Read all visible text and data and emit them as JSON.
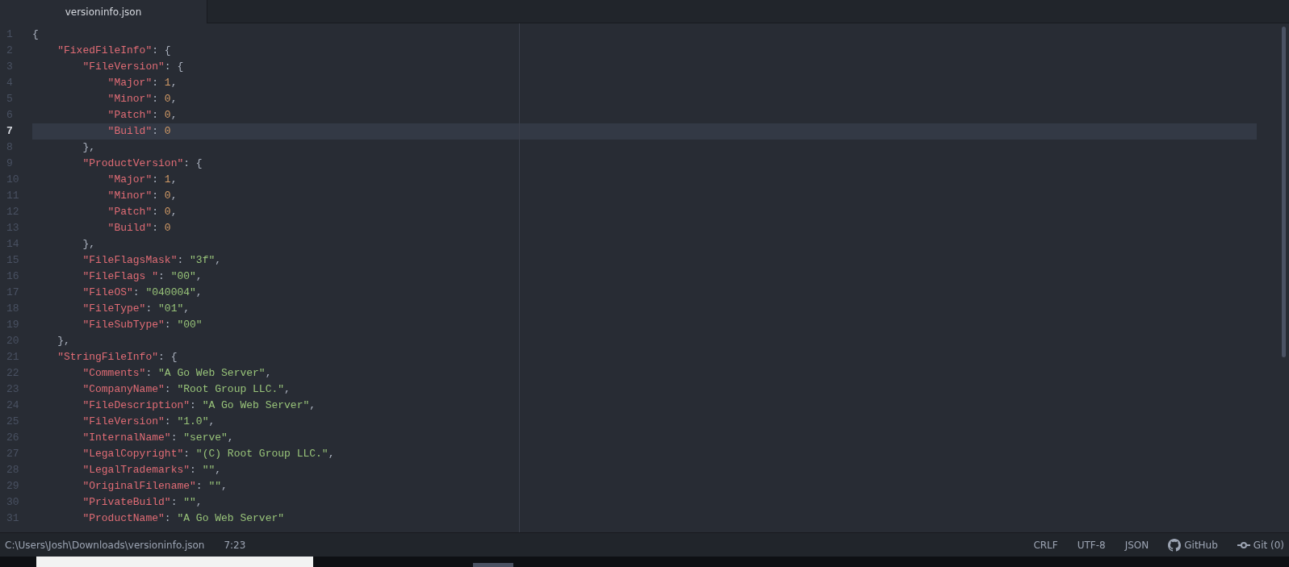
{
  "tabs": [
    {
      "label": "versioninfo.json",
      "selected": true
    }
  ],
  "lines": [
    {
      "number": "1",
      "selected": false,
      "tokens": [
        {
          "kind": "punct",
          "text": "{"
        }
      ]
    },
    {
      "number": "2",
      "selected": false,
      "tokens": [
        {
          "kind": "key",
          "text": "    \"FixedFileInfo\""
        },
        {
          "kind": "punct",
          "text": ": {"
        }
      ]
    },
    {
      "number": "3",
      "selected": false,
      "tokens": [
        {
          "kind": "key",
          "text": "        \"FileVersion\""
        },
        {
          "kind": "punct",
          "text": ": {"
        }
      ]
    },
    {
      "number": "4",
      "selected": false,
      "tokens": [
        {
          "kind": "key",
          "text": "            \"Major\""
        },
        {
          "kind": "punct",
          "text": ": "
        },
        {
          "kind": "number",
          "text": "1"
        },
        {
          "kind": "punct",
          "text": ","
        }
      ]
    },
    {
      "number": "5",
      "selected": false,
      "tokens": [
        {
          "kind": "key",
          "text": "            \"Minor\""
        },
        {
          "kind": "punct",
          "text": ": "
        },
        {
          "kind": "number",
          "text": "0"
        },
        {
          "kind": "punct",
          "text": ","
        }
      ]
    },
    {
      "number": "6",
      "selected": false,
      "tokens": [
        {
          "kind": "key",
          "text": "            \"Patch\""
        },
        {
          "kind": "punct",
          "text": ": "
        },
        {
          "kind": "number",
          "text": "0"
        },
        {
          "kind": "punct",
          "text": ","
        }
      ]
    },
    {
      "number": "7",
      "selected": true,
      "tokens": [
        {
          "kind": "key",
          "text": "            \"Build\""
        },
        {
          "kind": "punct",
          "text": ": "
        },
        {
          "kind": "number",
          "text": "0"
        }
      ]
    },
    {
      "number": "8",
      "selected": false,
      "tokens": [
        {
          "kind": "punct",
          "text": "        },"
        }
      ]
    },
    {
      "number": "9",
      "selected": false,
      "tokens": [
        {
          "kind": "key",
          "text": "        \"ProductVersion\""
        },
        {
          "kind": "punct",
          "text": ": {"
        }
      ]
    },
    {
      "number": "10",
      "selected": false,
      "tokens": [
        {
          "kind": "key",
          "text": "            \"Major\""
        },
        {
          "kind": "punct",
          "text": ": "
        },
        {
          "kind": "number",
          "text": "1"
        },
        {
          "kind": "punct",
          "text": ","
        }
      ]
    },
    {
      "number": "11",
      "selected": false,
      "tokens": [
        {
          "kind": "key",
          "text": "            \"Minor\""
        },
        {
          "kind": "punct",
          "text": ": "
        },
        {
          "kind": "number",
          "text": "0"
        },
        {
          "kind": "punct",
          "text": ","
        }
      ]
    },
    {
      "number": "12",
      "selected": false,
      "tokens": [
        {
          "kind": "key",
          "text": "            \"Patch\""
        },
        {
          "kind": "punct",
          "text": ": "
        },
        {
          "kind": "number",
          "text": "0"
        },
        {
          "kind": "punct",
          "text": ","
        }
      ]
    },
    {
      "number": "13",
      "selected": false,
      "tokens": [
        {
          "kind": "key",
          "text": "            \"Build\""
        },
        {
          "kind": "punct",
          "text": ": "
        },
        {
          "kind": "number",
          "text": "0"
        }
      ]
    },
    {
      "number": "14",
      "selected": false,
      "tokens": [
        {
          "kind": "punct",
          "text": "        },"
        }
      ]
    },
    {
      "number": "15",
      "selected": false,
      "tokens": [
        {
          "kind": "key",
          "text": "        \"FileFlagsMask\""
        },
        {
          "kind": "punct",
          "text": ": "
        },
        {
          "kind": "string",
          "text": "\"3f\""
        },
        {
          "kind": "punct",
          "text": ","
        }
      ]
    },
    {
      "number": "16",
      "selected": false,
      "tokens": [
        {
          "kind": "key",
          "text": "        \"FileFlags \""
        },
        {
          "kind": "punct",
          "text": ": "
        },
        {
          "kind": "string",
          "text": "\"00\""
        },
        {
          "kind": "punct",
          "text": ","
        }
      ]
    },
    {
      "number": "17",
      "selected": false,
      "tokens": [
        {
          "kind": "key",
          "text": "        \"FileOS\""
        },
        {
          "kind": "punct",
          "text": ": "
        },
        {
          "kind": "string",
          "text": "\"040004\""
        },
        {
          "kind": "punct",
          "text": ","
        }
      ]
    },
    {
      "number": "18",
      "selected": false,
      "tokens": [
        {
          "kind": "key",
          "text": "        \"FileType\""
        },
        {
          "kind": "punct",
          "text": ": "
        },
        {
          "kind": "string",
          "text": "\"01\""
        },
        {
          "kind": "punct",
          "text": ","
        }
      ]
    },
    {
      "number": "19",
      "selected": false,
      "tokens": [
        {
          "kind": "key",
          "text": "        \"FileSubType\""
        },
        {
          "kind": "punct",
          "text": ": "
        },
        {
          "kind": "string",
          "text": "\"00\""
        }
      ]
    },
    {
      "number": "20",
      "selected": false,
      "tokens": [
        {
          "kind": "punct",
          "text": "    },"
        }
      ]
    },
    {
      "number": "21",
      "selected": false,
      "tokens": [
        {
          "kind": "key",
          "text": "    \"StringFileInfo\""
        },
        {
          "kind": "punct",
          "text": ": {"
        }
      ]
    },
    {
      "number": "22",
      "selected": false,
      "tokens": [
        {
          "kind": "key",
          "text": "        \"Comments\""
        },
        {
          "kind": "punct",
          "text": ": "
        },
        {
          "kind": "string",
          "text": "\"A Go Web Server\""
        },
        {
          "kind": "punct",
          "text": ","
        }
      ]
    },
    {
      "number": "23",
      "selected": false,
      "tokens": [
        {
          "kind": "key",
          "text": "        \"CompanyName\""
        },
        {
          "kind": "punct",
          "text": ": "
        },
        {
          "kind": "string",
          "text": "\"Root Group LLC.\""
        },
        {
          "kind": "punct",
          "text": ","
        }
      ]
    },
    {
      "number": "24",
      "selected": false,
      "tokens": [
        {
          "kind": "key",
          "text": "        \"FileDescription\""
        },
        {
          "kind": "punct",
          "text": ": "
        },
        {
          "kind": "string",
          "text": "\"A Go Web Server\""
        },
        {
          "kind": "punct",
          "text": ","
        }
      ]
    },
    {
      "number": "25",
      "selected": false,
      "tokens": [
        {
          "kind": "key",
          "text": "        \"FileVersion\""
        },
        {
          "kind": "punct",
          "text": ": "
        },
        {
          "kind": "string",
          "text": "\"1.0\""
        },
        {
          "kind": "punct",
          "text": ","
        }
      ]
    },
    {
      "number": "26",
      "selected": false,
      "tokens": [
        {
          "kind": "key",
          "text": "        \"InternalName\""
        },
        {
          "kind": "punct",
          "text": ": "
        },
        {
          "kind": "string",
          "text": "\"serve\""
        },
        {
          "kind": "punct",
          "text": ","
        }
      ]
    },
    {
      "number": "27",
      "selected": false,
      "tokens": [
        {
          "kind": "key",
          "text": "        \"LegalCopyright\""
        },
        {
          "kind": "punct",
          "text": ": "
        },
        {
          "kind": "string",
          "text": "\"(C) Root Group LLC.\""
        },
        {
          "kind": "punct",
          "text": ","
        }
      ]
    },
    {
      "number": "28",
      "selected": false,
      "tokens": [
        {
          "kind": "key",
          "text": "        \"LegalTrademarks\""
        },
        {
          "kind": "punct",
          "text": ": "
        },
        {
          "kind": "string",
          "text": "\"\""
        },
        {
          "kind": "punct",
          "text": ","
        }
      ]
    },
    {
      "number": "29",
      "selected": false,
      "tokens": [
        {
          "kind": "key",
          "text": "        \"OriginalFilename\""
        },
        {
          "kind": "punct",
          "text": ": "
        },
        {
          "kind": "string",
          "text": "\"\""
        },
        {
          "kind": "punct",
          "text": ","
        }
      ]
    },
    {
      "number": "30",
      "selected": false,
      "tokens": [
        {
          "kind": "key",
          "text": "        \"PrivateBuild\""
        },
        {
          "kind": "punct",
          "text": ": "
        },
        {
          "kind": "string",
          "text": "\"\""
        },
        {
          "kind": "punct",
          "text": ","
        }
      ]
    },
    {
      "number": "31",
      "selected": false,
      "tokens": [
        {
          "kind": "key",
          "text": "        \"ProductName\""
        },
        {
          "kind": "punct",
          "text": ": "
        },
        {
          "kind": "string",
          "text": "\"A Go Web Server\""
        }
      ]
    }
  ],
  "status_bar": {
    "file_path": "C:\\Users\\Josh\\Downloads\\versioninfo.json",
    "cursor": "7:23",
    "items": [
      {
        "kind": "text",
        "label": "CRLF"
      },
      {
        "kind": "text",
        "label": "UTF-8"
      },
      {
        "kind": "text",
        "label": "JSON"
      },
      {
        "kind": "github",
        "label": "GitHub"
      },
      {
        "kind": "git",
        "label": "Git (0)"
      }
    ]
  }
}
